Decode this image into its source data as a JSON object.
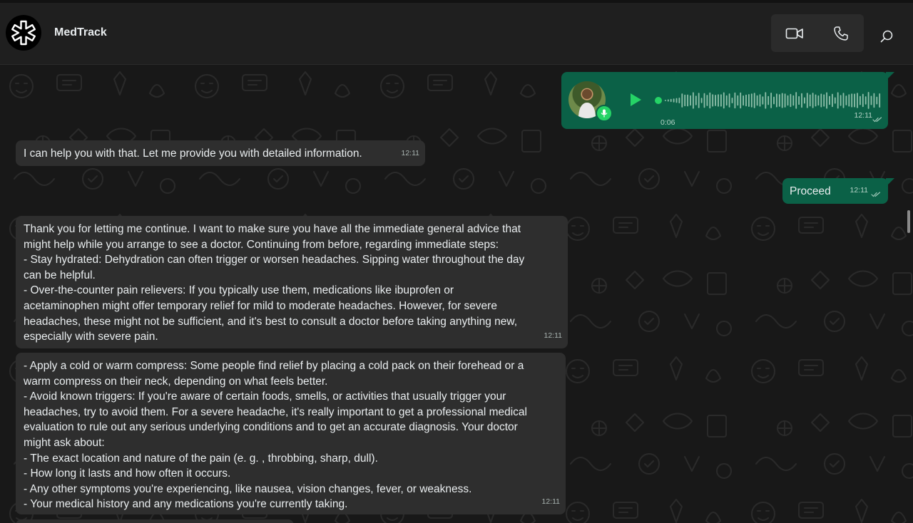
{
  "header": {
    "contact_name": "MedTrack"
  },
  "voice_message": {
    "duration": "0:06",
    "time": "12:11",
    "status": "read"
  },
  "messages": [
    {
      "id": "m1",
      "direction": "incoming",
      "text": "I can help you with that. Let me provide you with detailed information.",
      "time": "12:11"
    },
    {
      "id": "m2",
      "direction": "outgoing",
      "text": "Proceed",
      "time": "12:11",
      "status": "read"
    },
    {
      "id": "m3",
      "direction": "incoming",
      "text": "Thank you for letting me continue.  I want to make sure you have all the immediate general advice that\nmight help while you arrange to see a doctor.  Continuing from before, regarding immediate steps:\n- Stay hydrated: Dehydration can often trigger or worsen headaches.  Sipping water throughout the day\ncan be helpful.\n- Over-the-counter pain relievers: If you typically use them, medications like ibuprofen or\nacetaminophen might offer temporary relief for mild to moderate headaches.  However, for severe\nheadaches, these might not be sufficient, and it's best to consult a doctor before taking anything new,\nespecially with severe pain.",
      "time": "12:11"
    },
    {
      "id": "m4",
      "direction": "incoming",
      "text": "- Apply a cold or warm compress: Some people find relief by placing a cold pack on their forehead or a\nwarm compress on their neck, depending on what feels better.\n- Avoid known triggers: If you're aware of certain foods, smells, or activities that usually trigger your\nheadaches, try to avoid them.  For a severe headache, it's really important to get a professional medical\nevaluation to rule out any serious underlying conditions and to get an accurate diagnosis.  Your doctor\nmight ask about:\n- The exact location and nature of the pain (e. g. , throbbing, sharp, dull).\n- How long it lasts and how often it occurs.\n- Any other symptoms you're experiencing, like nausea, vision changes, fever, or weakness.\n- Your medical history and any medications you're currently taking.",
      "time": "12:11"
    }
  ],
  "icons": {
    "logo": "medical-star-icon",
    "video": "video-camera-icon",
    "call": "phone-icon",
    "search": "search-icon",
    "play": "play-icon",
    "mic": "microphone-icon",
    "ticks": "double-check-icon"
  },
  "colors": {
    "incoming_bubble": "#2e2e2e",
    "outgoing_bubble": "#0b6147",
    "accent_green": "#25d366",
    "background": "#181818"
  }
}
